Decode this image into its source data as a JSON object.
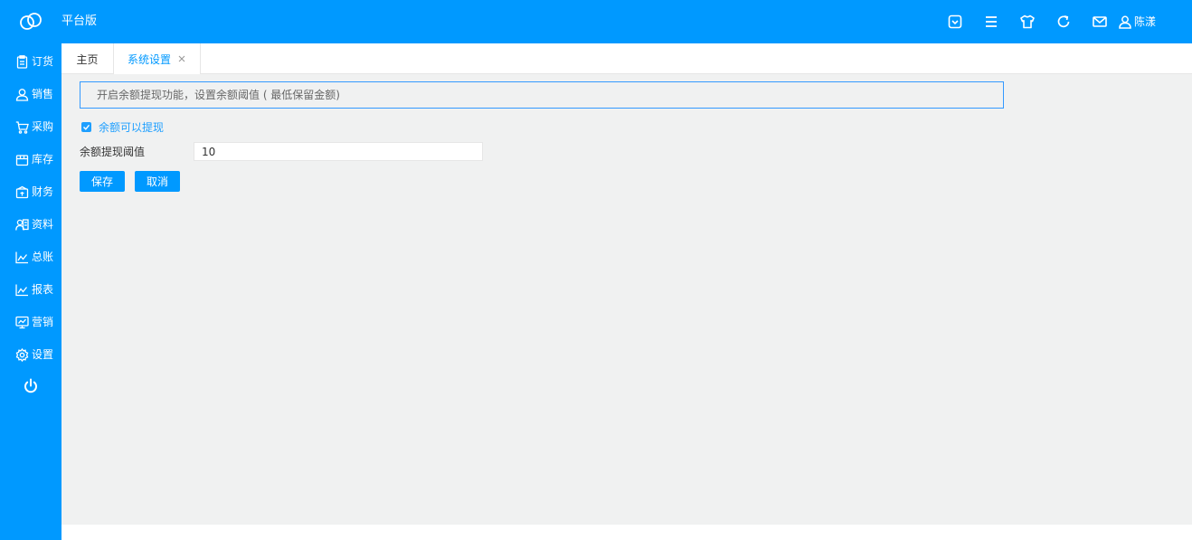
{
  "header": {
    "app_title": "平台版",
    "icons": [
      "wechat-pocket-icon",
      "menu-icon",
      "shirt-icon",
      "refresh-icon",
      "mail-icon",
      "user-icon"
    ],
    "user_name": "陈漾"
  },
  "sidebar": {
    "items": [
      {
        "label": "订货",
        "icon": "clipboard-icon"
      },
      {
        "label": "销售",
        "icon": "person-icon"
      },
      {
        "label": "采购",
        "icon": "cart-icon"
      },
      {
        "label": "库存",
        "icon": "box-icon"
      },
      {
        "label": "财务",
        "icon": "wallet-icon"
      },
      {
        "label": "资料",
        "icon": "contact-card-icon"
      },
      {
        "label": "总账",
        "icon": "line-chart-icon"
      },
      {
        "label": "报表",
        "icon": "line-chart-icon"
      },
      {
        "label": "营销",
        "icon": "monitor-chart-icon"
      },
      {
        "label": "设置",
        "icon": "gear-icon"
      }
    ],
    "power_icon": "power-icon"
  },
  "tabs": {
    "home": "主页",
    "active": "系统设置"
  },
  "form": {
    "notice": "开启余额提现功能，设置余额阈值 ( 最低保留金额)",
    "checkbox_label": "余额可以提现",
    "checkbox_checked": true,
    "threshold_label": "余额提现阈值",
    "threshold_value": "10",
    "save_label": "保存",
    "cancel_label": "取消"
  },
  "colors": {
    "primary": "#0099ff",
    "content_bg": "#f0f1f1",
    "checkbox": "#1e9fff"
  }
}
